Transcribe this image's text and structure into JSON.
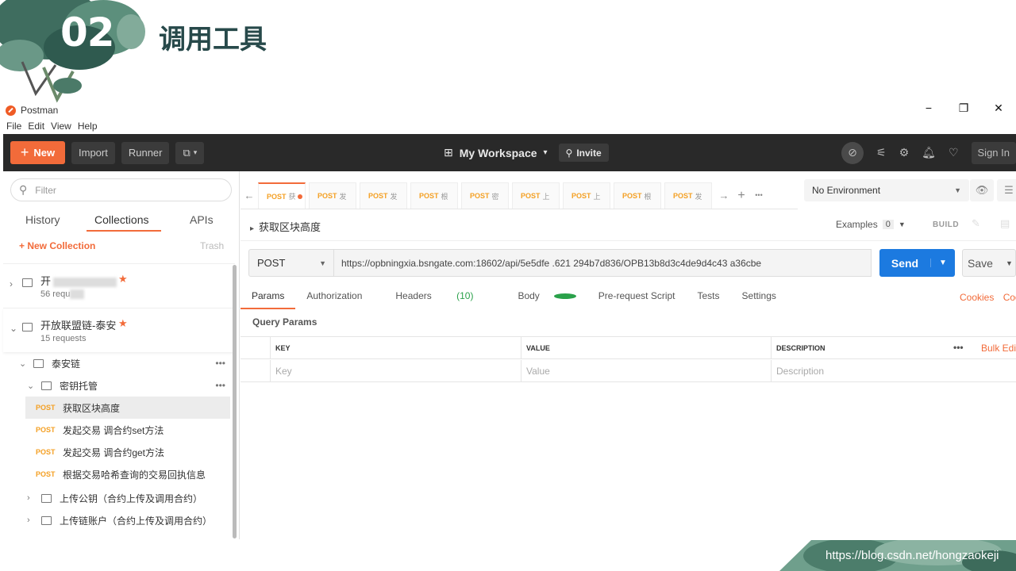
{
  "slide": {
    "number": "02",
    "title": "调用工具"
  },
  "window": {
    "app_title": "Postman"
  },
  "menubar": [
    "File",
    "Edit",
    "View",
    "Help"
  ],
  "header": {
    "new_label": "New",
    "import_label": "Import",
    "runner_label": "Runner",
    "workspace_label": "My Workspace",
    "invite_label": "Invite",
    "signin_label": "Sign In"
  },
  "sidebar": {
    "filter_placeholder": "Filter",
    "tabs": [
      "History",
      "Collections",
      "APIs"
    ],
    "active_tab": "Collections",
    "new_collection_label": "+ New Collection",
    "trash_label": "Trash",
    "collections": [
      {
        "name": "开",
        "count": "56 requ",
        "starred": true
      },
      {
        "name": "开放联盟链-泰安",
        "count": "15 requests",
        "starred": true
      }
    ],
    "tree": {
      "folder1": "泰安链",
      "folder2": "密钥托管",
      "requests": [
        {
          "method": "POST",
          "name": "获取区块高度",
          "selected": true
        },
        {
          "method": "POST",
          "name": "发起交易 调合约set方法"
        },
        {
          "method": "POST",
          "name": "发起交易 调合约get方法"
        },
        {
          "method": "POST",
          "name": "根据交易哈希查询的交易回执信息"
        }
      ],
      "folder3": "上传公钥（合约上传及调用合约）",
      "folder4": "上传链账户（合约上传及调用合约）"
    }
  },
  "tabs": [
    {
      "method": "POST",
      "name": "获",
      "active": true,
      "unsaved": true
    },
    {
      "method": "POST",
      "name": "发"
    },
    {
      "method": "POST",
      "name": "发"
    },
    {
      "method": "POST",
      "name": "根"
    },
    {
      "method": "POST",
      "name": "密"
    },
    {
      "method": "POST",
      "name": "上"
    },
    {
      "method": "POST",
      "name": "上"
    },
    {
      "method": "POST",
      "name": "根"
    },
    {
      "method": "POST",
      "name": "发"
    }
  ],
  "environment": {
    "selected": "No Environment"
  },
  "request": {
    "title": "获取区块高度",
    "examples_label": "Examples",
    "examples_count": "0",
    "build_label": "BUILD",
    "method": "POST",
    "url": "https://opbningxia.bsngate.com:18602/api/5e5dfe           .621              294b7d836/OPB13b8d3c4de9d4c43                 a36cbe",
    "send_label": "Send",
    "save_label": "Save"
  },
  "subtabs": {
    "params": "Params",
    "authorization": "Authorization",
    "headers": "Headers",
    "headers_count": "(10)",
    "body": "Body",
    "prerequest": "Pre-request Script",
    "tests": "Tests",
    "settings": "Settings",
    "cookies": "Cookies",
    "code": "Code"
  },
  "params": {
    "section_label": "Query Params",
    "columns": [
      "KEY",
      "VALUE",
      "DESCRIPTION"
    ],
    "placeholders": [
      "Key",
      "Value",
      "Description"
    ],
    "more_label": "•••",
    "bulk_edit_label": "Bulk Edit"
  },
  "watermark": "https://blog.csdn.net/hongzaokeji",
  "colors": {
    "accent": "#f26b3a",
    "send": "#1c7ae0",
    "header_bg": "#292929",
    "post": "#f4a024",
    "title": "#27494a"
  }
}
